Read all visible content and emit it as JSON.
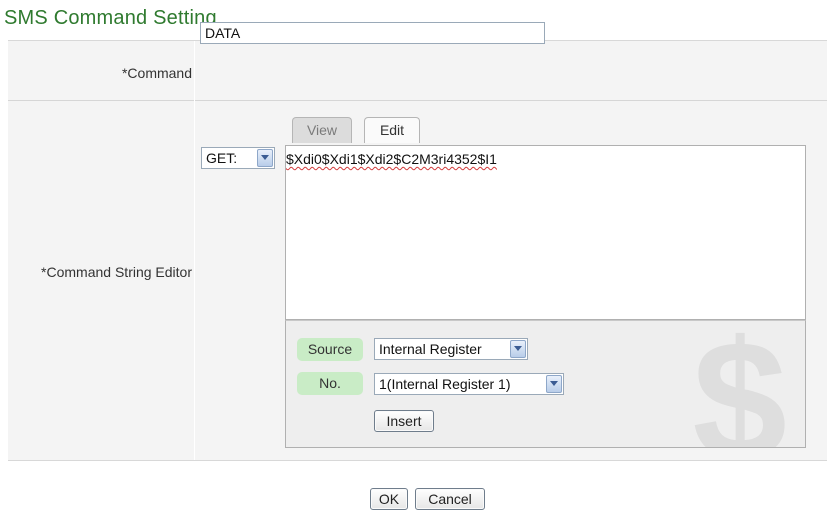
{
  "page": {
    "title": "SMS Command Setting"
  },
  "command": {
    "label": "*Command",
    "value": "DATA"
  },
  "editor": {
    "label": "*Command String Editor",
    "tabs": [
      {
        "label": "View",
        "active": false
      },
      {
        "label": "Edit",
        "active": true
      }
    ],
    "method_select": "GET:",
    "text": "$Xdi0$Xdi1$Xdi2$C2M3ri4352$I1",
    "source_label": "Source",
    "source_value": "Internal Register",
    "no_label": "No.",
    "no_value": "1(Internal Register 1)",
    "insert_label": "Insert",
    "watermark": "$"
  },
  "footer": {
    "ok_label": "OK",
    "cancel_label": "Cancel"
  },
  "colors": {
    "title": "#2f7a2f",
    "chip": "#c9ecc6",
    "background": "#f4f4f4"
  }
}
